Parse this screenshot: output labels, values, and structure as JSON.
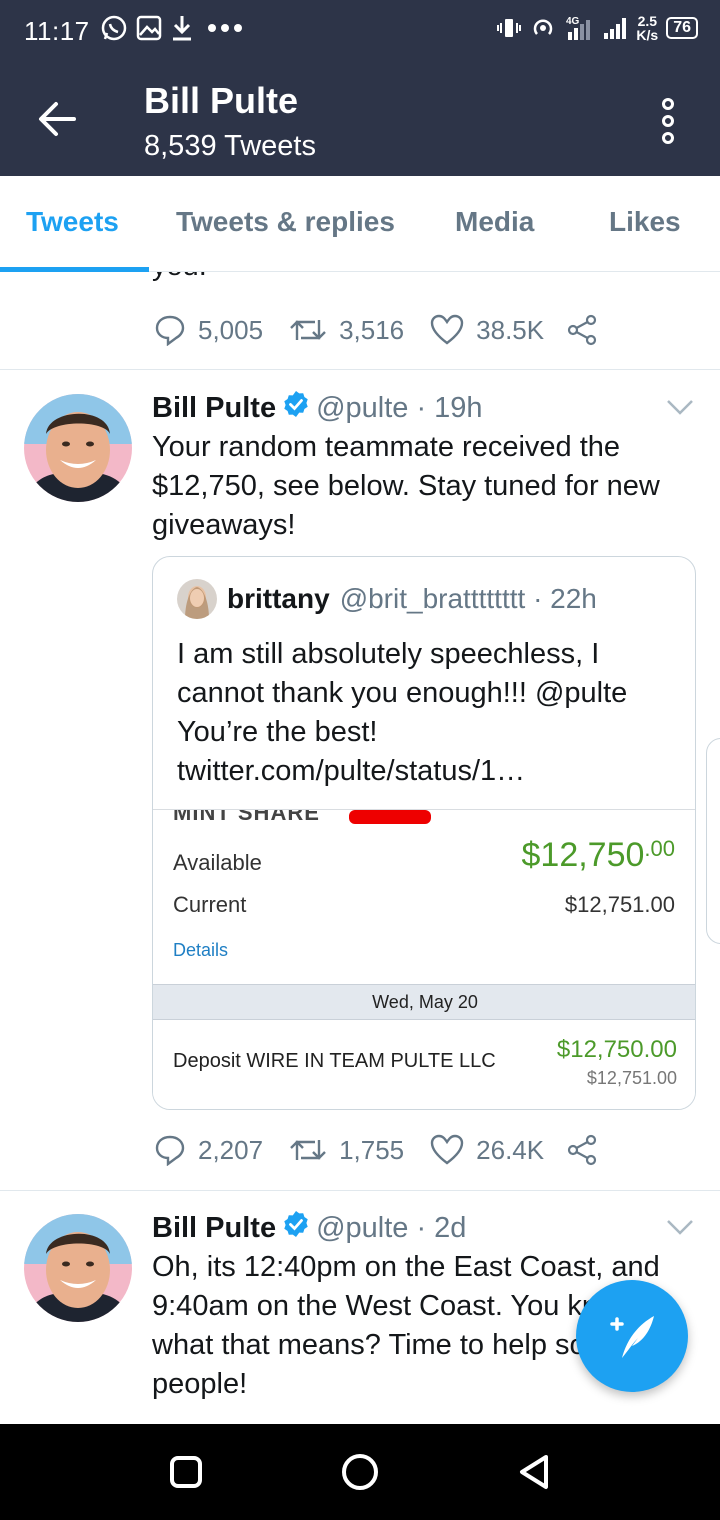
{
  "status_bar": {
    "time": "11:17",
    "network_type": "4G",
    "net_speed_value": "2.5",
    "net_speed_unit": "K/s",
    "battery": "76"
  },
  "header": {
    "name": "Bill Pulte",
    "tweet_count": "8,539 Tweets"
  },
  "tabs": [
    {
      "label": "Tweets",
      "active": true
    },
    {
      "label": "Tweets & replies",
      "active": false
    },
    {
      "label": "Media",
      "active": false
    },
    {
      "label": "Likes",
      "active": false
    }
  ],
  "tweets": [
    {
      "partial_text": "you.",
      "replies": "5,005",
      "retweets": "3,516",
      "likes": "38.5K"
    },
    {
      "name": "Bill Pulte",
      "handle_time": "@pulte · 19h",
      "text": "Your random teammate received the $12,750, see below.  Stay tuned for new giveaways!",
      "quote": {
        "name": "brittany",
        "handle_time": "@brit_bratttttttt · 22h",
        "text": "I am still absolutely speechless, I cannot thank you enough!!! @pulte You’re the best! twitter.com/pulte/status/1…",
        "image": {
          "header_text": "MINT SHARE",
          "available_label": "Available",
          "available_amount": "$12,750",
          "available_cents": ".00",
          "current_label": "Current",
          "current_amount": "$12,751.00",
          "details_link": "Details",
          "date": "Wed, May 20",
          "deposit_label": "Deposit WIRE IN TEAM PULTE LLC",
          "deposit_amount": "$12,750.00",
          "deposit_balance": "$12,751.00"
        }
      },
      "replies": "2,207",
      "retweets": "1,755",
      "likes": "26.4K"
    },
    {
      "name": "Bill Pulte",
      "handle_time": "@pulte · 2d",
      "text": "Oh, its 12:40pm on the East Coast, and 9:40am on the West Coast. You know what that means? Time to help some people!"
    }
  ],
  "colors": {
    "header_bg": "#2d3448",
    "accent": "#1da1f2",
    "secondary_text": "#657786",
    "money_green": "#4c9a2a"
  }
}
